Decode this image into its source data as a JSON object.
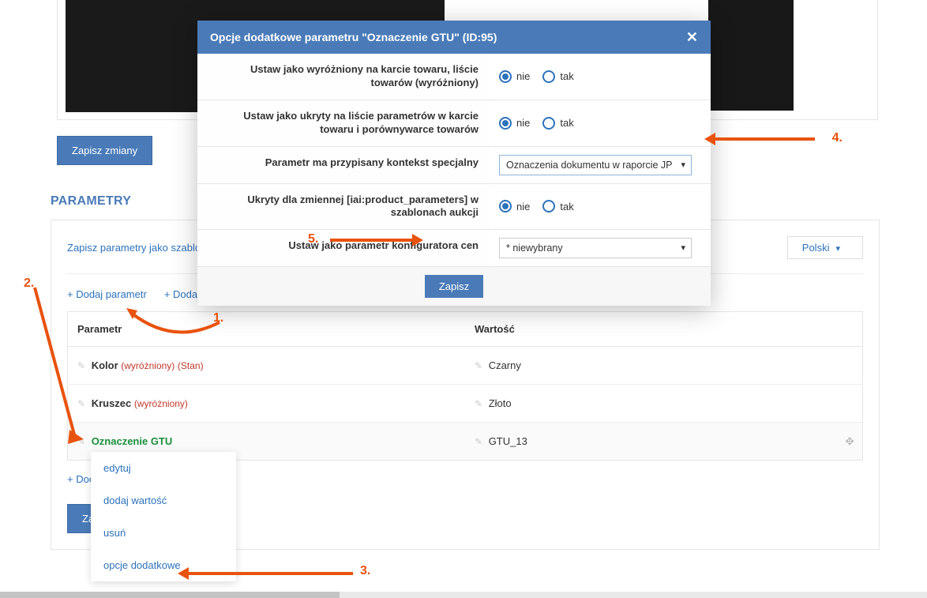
{
  "save_changes": "Zapisz zmiany",
  "section_title": "PARAMETRY",
  "save_params_as_template": "Zapisz parametry jako szablon",
  "language": "Polski",
  "add_parameter": "+ Dodaj parametr",
  "add_section": "+ Dodaj sekcję",
  "table": {
    "col_param": "Parametr",
    "col_value": "Wartość",
    "rows": [
      {
        "name": "Kolor",
        "tag_w": "(wyróżniony)",
        "tag_s": "(Stan)",
        "value": "Czarny"
      },
      {
        "name": "Kruszec",
        "tag_w": "(wyróżniony)",
        "tag_s": "",
        "value": "Złoto"
      },
      {
        "name": "Oznaczenie GTU",
        "tag_w": "",
        "tag_s": "",
        "value": "GTU_13",
        "selected": true
      }
    ]
  },
  "add_bottom_short": "+  Doc",
  "save_bottom_short": "Zapi",
  "ctx_menu": {
    "edit": "edytuj",
    "add_value": "dodaj wartość",
    "delete": "usuń",
    "extra": "opcje dodatkowe"
  },
  "modal": {
    "title": "Opcje dodatkowe parametru \"Oznaczenie GTU\" (ID:95)",
    "rows": {
      "row1_label": "Ustaw jako wyróżniony na karcie towaru, liście towarów (wyróżniony)",
      "row2_label": "Ustaw jako ukryty na liście parametrów w karcie towaru i porównywarce towarów",
      "row3_label": "Parametr ma przypisany kontekst specjalny",
      "row3_value": "Oznaczenia dokumentu w raporcie JPK_",
      "row4_label": "Ukryty dla zmiennej [iai:product_parameters] w szablonach aukcji",
      "row5_label": "Ustaw jako parametr konfiguratora cen",
      "row5_value": "* niewybrany"
    },
    "radio_no": "nie",
    "radio_yes": "tak",
    "save": "Zapisz"
  },
  "annotations": {
    "n1": "1.",
    "n2": "2.",
    "n3": "3.",
    "n4": "4.",
    "n5": "5."
  }
}
